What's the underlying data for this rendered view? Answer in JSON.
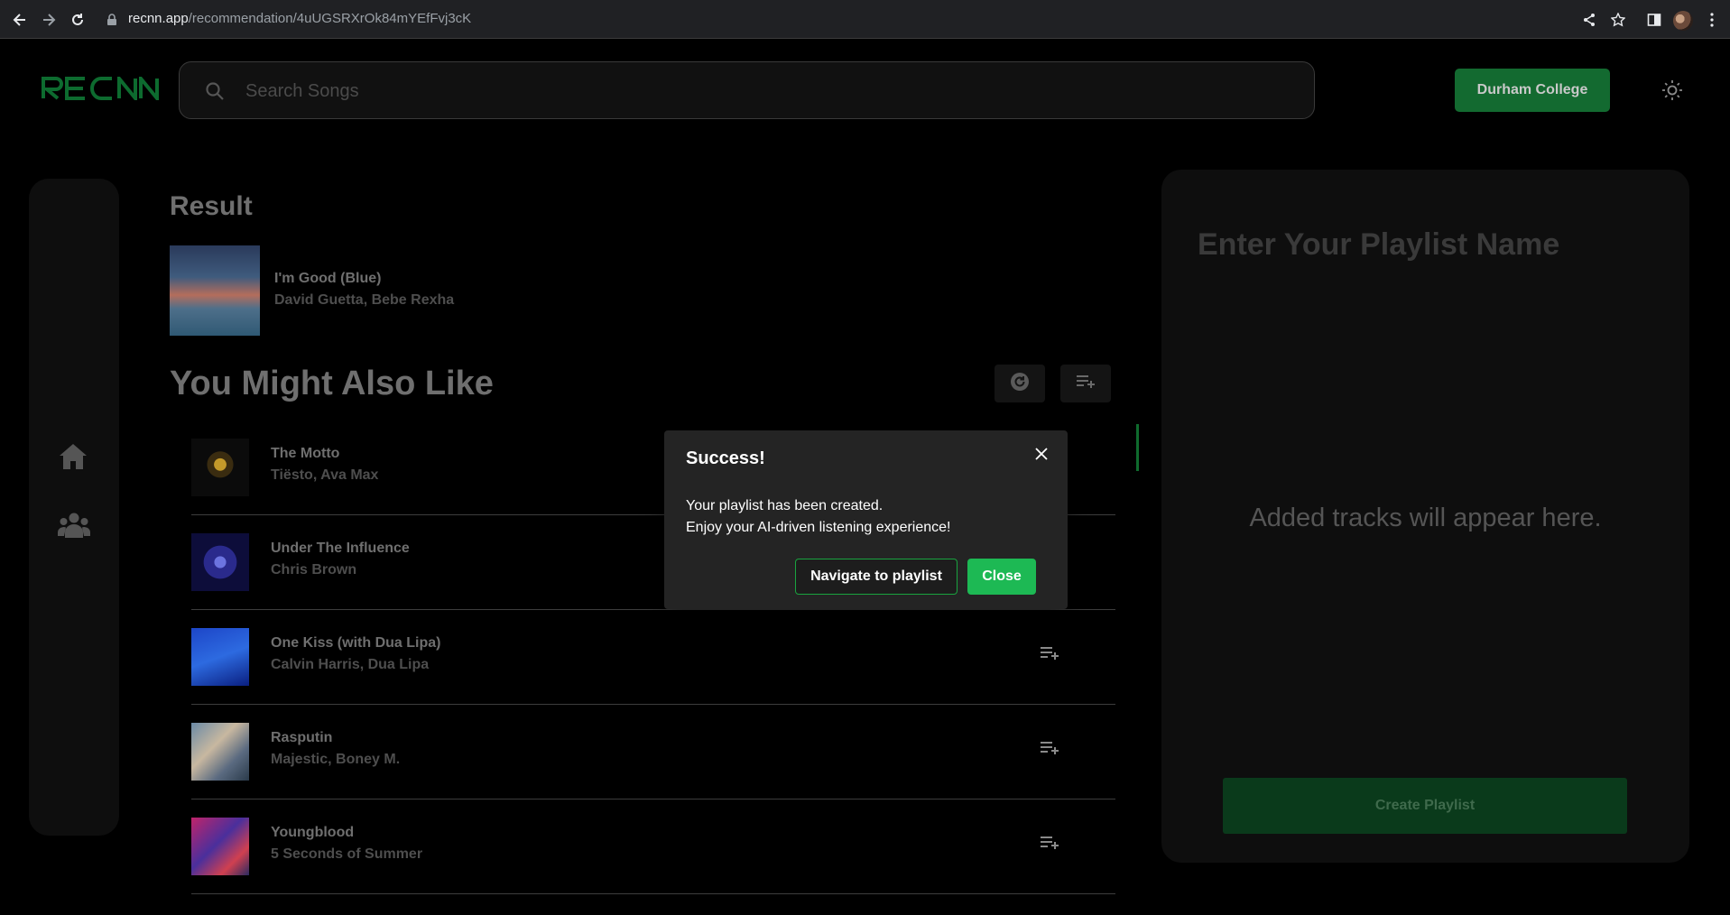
{
  "browser": {
    "url_host": "recnn.app",
    "url_path": "/recommendation/4uUGSRXrOk84mYEfFvj3cK"
  },
  "header": {
    "logo_text": "RECNN",
    "search_placeholder": "Search Songs",
    "account_button": "Durham College"
  },
  "result": {
    "title": "Result",
    "song": "I'm Good (Blue)",
    "artist": "David Guetta, Bebe Rexha"
  },
  "recommendations": {
    "title": "You Might Also Like",
    "tracks": [
      {
        "song": "The Motto",
        "artist": "Tiësto, Ava Max"
      },
      {
        "song": "Under The Influence",
        "artist": "Chris Brown"
      },
      {
        "song": "One Kiss (with Dua Lipa)",
        "artist": "Calvin Harris, Dua Lipa"
      },
      {
        "song": "Rasputin",
        "artist": "Majestic, Boney M."
      },
      {
        "song": "Youngblood",
        "artist": "5 Seconds of Summer"
      }
    ]
  },
  "playlist": {
    "name_placeholder": "Enter Your Playlist Name",
    "empty_text": "Added tracks will appear here.",
    "create_button": "Create Playlist"
  },
  "modal": {
    "title": "Success!",
    "message_line1": "Your playlist has been created.",
    "message_line2": "Enjoy your AI-driven listening experience!",
    "navigate_button": "Navigate to playlist",
    "close_button": "Close"
  },
  "colors": {
    "accent": "#1db954",
    "accent_dim": "#136a30",
    "background": "#000000",
    "modal_bg": "#242424"
  }
}
